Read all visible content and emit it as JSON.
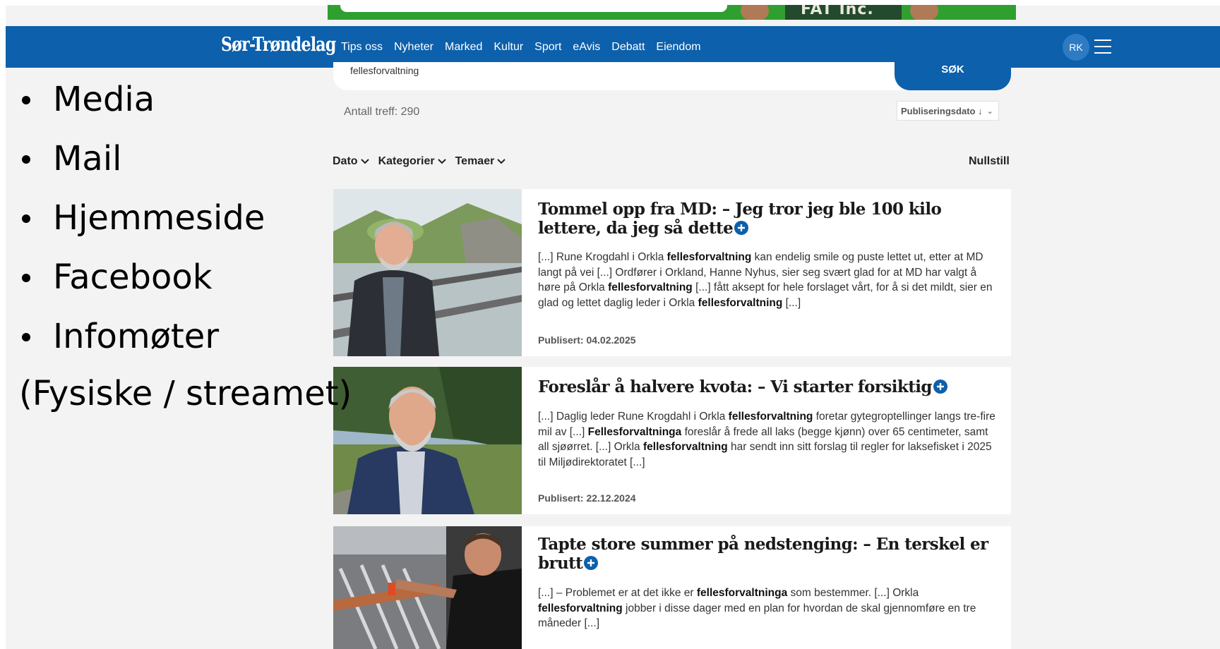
{
  "ad": {
    "shirt_text": "FAT Inc."
  },
  "site": {
    "logo": "Sør-Trøndelag",
    "nav": [
      "Tips oss",
      "Nyheter",
      "Marked",
      "Kultur",
      "Sport",
      "eAvis",
      "Debatt",
      "Eiendom"
    ],
    "avatar_initials": "RK"
  },
  "overlay": {
    "bullets": [
      "Media",
      "Mail",
      "Hjemmeside",
      "Facebook",
      "Infomøter"
    ],
    "note": "(Fysiske / streamet)"
  },
  "search": {
    "value": "fellesforvaltning",
    "button": "SØK",
    "hits": "Antall treff: 290",
    "sort": "Publiseringsdato ↓"
  },
  "filters": [
    "Dato",
    "Kategorier",
    "Temaer"
  ],
  "reset_label": "Nullstill",
  "articles": [
    {
      "title": "Tommel opp fra MD: – Jeg tror jeg ble 100 kilo lettere, da jeg så dette",
      "excerpt": [
        "[...] Rune Krogdahl i Orkla ",
        {
          "b": "fellesforvaltning"
        },
        " kan endelig smile og puste lettet ut, etter at MD langt på vei [...] Ordfører i Orkland, Hanne Nyhus, sier seg svært glad for at MD har valgt å høre på Orkla ",
        {
          "b": "fellesforvaltning"
        },
        " [...] fått aksept for hele forslaget vårt, for å si det mildt, sier en glad og lettet daglig leder i Orkla ",
        {
          "b": "fellesforvaltning"
        },
        " [...]"
      ],
      "date": "Publisert: 04.02.2025"
    },
    {
      "title": "Foreslår å halvere kvota: – Vi starter forsiktig",
      "excerpt": [
        "[...] Daglig leder Rune Krogdahl i Orkla ",
        {
          "b": "fellesforvaltning"
        },
        " foretar gytegroptellinger langs tre-fire mil av [...] ",
        {
          "b": "Fellesforvaltninga"
        },
        " foreslår å frede all laks (begge kjønn) over 65 centimeter, samt all sjøørret. [...] Orkla ",
        {
          "b": "fellesforvaltning"
        },
        " har sendt inn sitt forslag til regler for laksefisket i 2025 til Miljødirektoratet [...]"
      ],
      "date": "Publisert: 22.12.2024"
    },
    {
      "title": "Tapte store summer på nedstenging: – En terskel er brutt",
      "excerpt": [
        "[...] – Problemet er at det ikke er ",
        {
          "b": "fellesforvaltninga"
        },
        " som bestemmer. [...] Orkla ",
        {
          "b": "fellesforvaltning"
        },
        " jobber i disse dager med en plan for hvordan de skal gjennomføre en tre måneder [...]"
      ],
      "date": ""
    }
  ],
  "colors": {
    "brand": "#0d60ab",
    "background": "#f3f3f3",
    "ad_green": "#2fa02f"
  }
}
